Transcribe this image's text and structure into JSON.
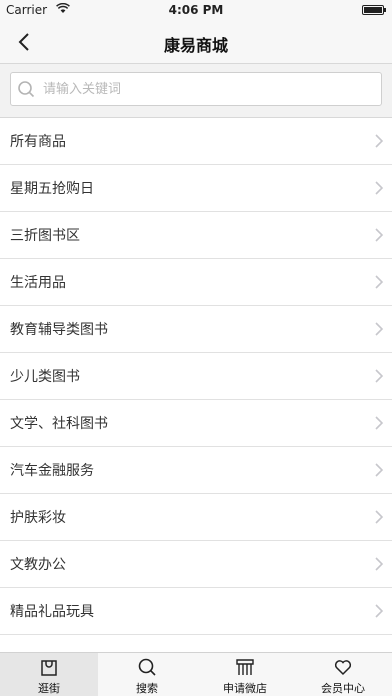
{
  "status_bar": {
    "carrier": "Carrier",
    "time": "4:06 PM"
  },
  "nav": {
    "title": "康易商城",
    "back_icon": "chevron-left-icon"
  },
  "search": {
    "placeholder": "请输入关键词",
    "value": "",
    "icon": "search-icon"
  },
  "categories": [
    "所有商品",
    "星期五抢购日",
    "三折图书区",
    "生活用品",
    "教育辅导类图书",
    "少儿类图书",
    "文学、社科图书",
    "汽车金融服务",
    "护肤彩妆",
    "文教办公",
    "精品礼品玩具"
  ],
  "tabs": [
    {
      "label": "逛街",
      "icon": "bag-icon",
      "active": true
    },
    {
      "label": "搜索",
      "icon": "search-icon",
      "active": false
    },
    {
      "label": "申请微店",
      "icon": "shop-icon",
      "active": false
    },
    {
      "label": "会员中心",
      "icon": "heart-icon",
      "active": false
    }
  ],
  "colors": {
    "background": "#f2f2f2",
    "bar": "#f7f7f7",
    "active_tab": "#e6e6e6",
    "chevron": "#c7c7cc"
  }
}
